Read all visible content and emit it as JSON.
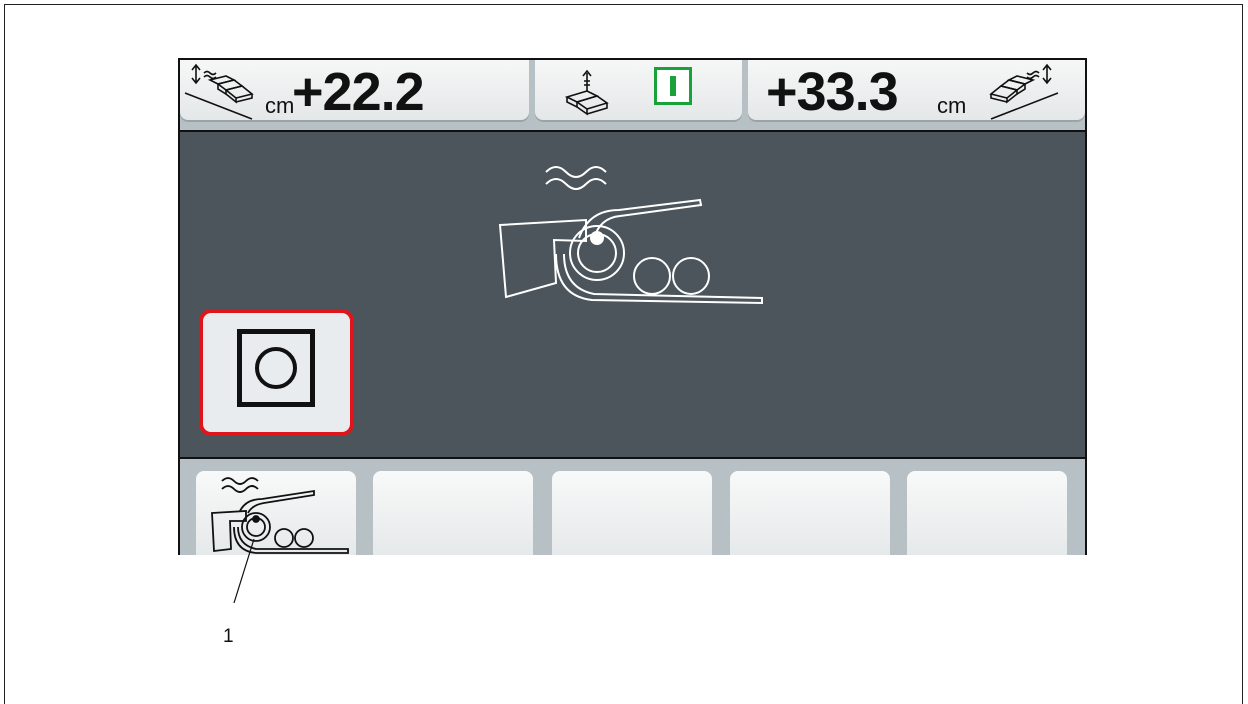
{
  "header": {
    "left_value": "+22.2",
    "left_unit": "cm",
    "right_value": "+33.3",
    "right_unit": "cm",
    "left_icon": "screed-slope-left-icon",
    "middle_icon": "screed-height-icon",
    "status_indicator": "I",
    "right_icon": "screed-slope-right-icon"
  },
  "main": {
    "central_icon": "conveyor-roller-vibration-icon",
    "stop_button_icon": "stop-circle-icon"
  },
  "softkeys": [
    {
      "icon": "conveyor-roller-vibration-icon",
      "label": ""
    },
    {
      "icon": "",
      "label": ""
    },
    {
      "icon": "",
      "label": ""
    },
    {
      "icon": "",
      "label": ""
    },
    {
      "icon": "",
      "label": ""
    }
  ],
  "callout": {
    "number": "1"
  },
  "colors": {
    "screen_bg": "#4b555b",
    "status_green": "#1aa23a",
    "stop_red": "#e0151b"
  }
}
